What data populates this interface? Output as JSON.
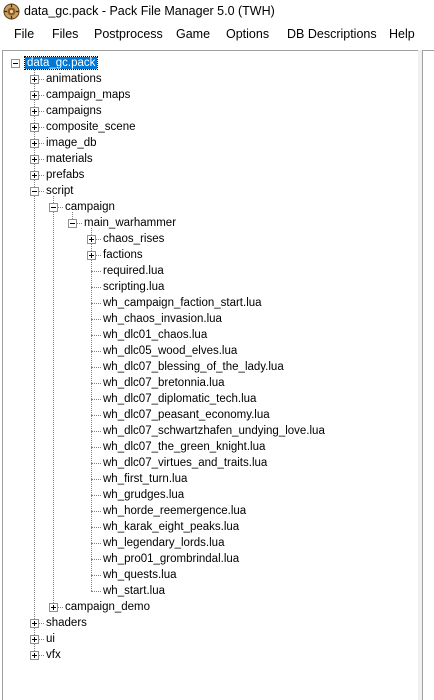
{
  "window": {
    "title": "data_gc.pack - Pack File Manager 5.0 (TWH)"
  },
  "menu": [
    {
      "label": "File"
    },
    {
      "label": "Files"
    },
    {
      "label": "Postprocess"
    },
    {
      "label": "Game"
    },
    {
      "label": "Options"
    },
    {
      "label": "DB Descriptions"
    },
    {
      "label": "Help"
    }
  ],
  "tree": [
    {
      "label": "data_gc.pack",
      "depth": 0,
      "expander": "expanded",
      "selected": true
    },
    {
      "label": "animations",
      "depth": 1,
      "expander": "collapsed"
    },
    {
      "label": "campaign_maps",
      "depth": 1,
      "expander": "collapsed"
    },
    {
      "label": "campaigns",
      "depth": 1,
      "expander": "collapsed"
    },
    {
      "label": "composite_scene",
      "depth": 1,
      "expander": "collapsed"
    },
    {
      "label": "image_db",
      "depth": 1,
      "expander": "collapsed"
    },
    {
      "label": "materials",
      "depth": 1,
      "expander": "collapsed"
    },
    {
      "label": "prefabs",
      "depth": 1,
      "expander": "collapsed"
    },
    {
      "label": "script",
      "depth": 1,
      "expander": "expanded"
    },
    {
      "label": "campaign",
      "depth": 2,
      "expander": "expanded"
    },
    {
      "label": "main_warhammer",
      "depth": 3,
      "expander": "expanded"
    },
    {
      "label": "chaos_rises",
      "depth": 4,
      "expander": "collapsed"
    },
    {
      "label": "factions",
      "depth": 4,
      "expander": "collapsed"
    },
    {
      "label": "required.lua",
      "depth": 4,
      "expander": "none"
    },
    {
      "label": "scripting.lua",
      "depth": 4,
      "expander": "none"
    },
    {
      "label": "wh_campaign_faction_start.lua",
      "depth": 4,
      "expander": "none"
    },
    {
      "label": "wh_chaos_invasion.lua",
      "depth": 4,
      "expander": "none"
    },
    {
      "label": "wh_dlc01_chaos.lua",
      "depth": 4,
      "expander": "none"
    },
    {
      "label": "wh_dlc05_wood_elves.lua",
      "depth": 4,
      "expander": "none"
    },
    {
      "label": "wh_dlc07_blessing_of_the_lady.lua",
      "depth": 4,
      "expander": "none"
    },
    {
      "label": "wh_dlc07_bretonnia.lua",
      "depth": 4,
      "expander": "none"
    },
    {
      "label": "wh_dlc07_diplomatic_tech.lua",
      "depth": 4,
      "expander": "none"
    },
    {
      "label": "wh_dlc07_peasant_economy.lua",
      "depth": 4,
      "expander": "none"
    },
    {
      "label": "wh_dlc07_schwartzhafen_undying_love.lua",
      "depth": 4,
      "expander": "none"
    },
    {
      "label": "wh_dlc07_the_green_knight.lua",
      "depth": 4,
      "expander": "none"
    },
    {
      "label": "wh_dlc07_virtues_and_traits.lua",
      "depth": 4,
      "expander": "none"
    },
    {
      "label": "wh_first_turn.lua",
      "depth": 4,
      "expander": "none"
    },
    {
      "label": "wh_grudges.lua",
      "depth": 4,
      "expander": "none"
    },
    {
      "label": "wh_horde_reemergence.lua",
      "depth": 4,
      "expander": "none"
    },
    {
      "label": "wh_karak_eight_peaks.lua",
      "depth": 4,
      "expander": "none"
    },
    {
      "label": "wh_legendary_lords.lua",
      "depth": 4,
      "expander": "none"
    },
    {
      "label": "wh_pro01_grombrindal.lua",
      "depth": 4,
      "expander": "none"
    },
    {
      "label": "wh_quests.lua",
      "depth": 4,
      "expander": "none"
    },
    {
      "label": "wh_start.lua",
      "depth": 4,
      "expander": "none"
    },
    {
      "label": "campaign_demo",
      "depth": 2,
      "expander": "collapsed"
    },
    {
      "label": "shaders",
      "depth": 1,
      "expander": "collapsed"
    },
    {
      "label": "ui",
      "depth": 1,
      "expander": "collapsed"
    },
    {
      "label": "vfx",
      "depth": 1,
      "expander": "collapsed"
    }
  ],
  "colors": {
    "selection": "#0078d7",
    "treeLines": "#808080"
  }
}
